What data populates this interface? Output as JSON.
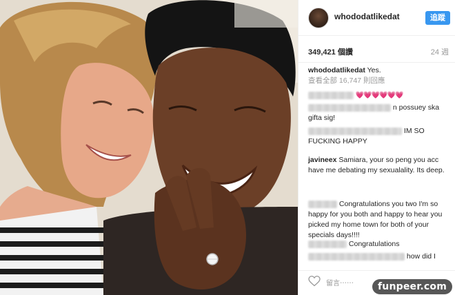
{
  "post": {
    "username": "whododatlikedat",
    "follow_label": "追蹤",
    "views": "349,421 個讚",
    "time_ago": "24 週"
  },
  "caption": {
    "author": "whododatlikedat",
    "text": "Yes.",
    "view_all": "查看全部 16,747 則回應"
  },
  "comments": [
    {
      "hearts": "💗💗💗💗💗💗"
    },
    {
      "text": "n possuey ska gifta sig!"
    },
    {
      "text": "IM SO FUCKING HAPPY"
    },
    {
      "author": "javineex",
      "text": "Samiara, your so peng you acc have me debating my sexualality. Its deep."
    },
    {
      "text": "Congratulations you two I'm so happy for you both and happy to hear you picked my home town for both of your specials days!!!!"
    },
    {
      "text": "Congratulations"
    },
    {
      "text": "how did I"
    }
  ],
  "footer": {
    "comment_placeholder": "留言⋯⋯",
    "heart_icon": "heart-outline-icon"
  },
  "watermark": "funpeer.com",
  "colors": {
    "accent": "#3897f0",
    "heart": "#ed4956",
    "muted": "#999999"
  }
}
